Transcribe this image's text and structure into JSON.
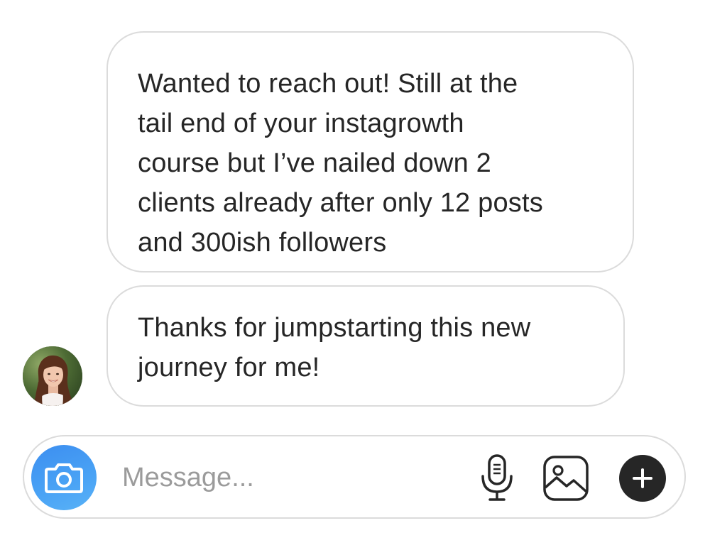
{
  "messages": [
    {
      "lines": [
        "Wanted to reach out! Still at the",
        "tail end of your instagrowth",
        "course but I’ve nailed down 2",
        "clients already after only 12 posts",
        "and 300ish followers"
      ]
    },
    {
      "lines": [
        "Thanks for jumpstarting this new",
        "journey for me!"
      ]
    }
  ],
  "composer": {
    "placeholder": "Message...",
    "value": ""
  },
  "icons": {
    "camera": "camera-icon",
    "microphone": "microphone-icon",
    "gallery": "gallery-icon",
    "add": "plus-icon",
    "avatar": "sender-avatar"
  },
  "colors": {
    "bubble_border": "#dbdbdb",
    "text": "#262626",
    "placeholder": "#9b9b9b",
    "camera_button": "#3c8ef0",
    "plus_button": "#262626"
  }
}
